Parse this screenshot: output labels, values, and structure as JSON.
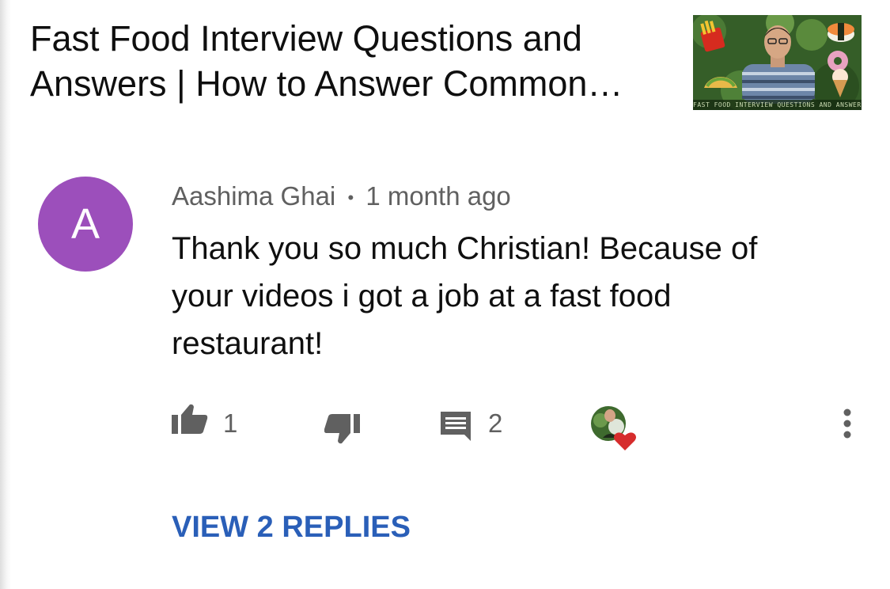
{
  "video": {
    "title_line1": "Fast Food Interview Questions and",
    "title_line2": "Answers | How to Answer Common…",
    "thumbnail_caption": "FAST FOOD INTERVIEW QUESTIONS AND ANSWERS"
  },
  "comment": {
    "avatar_letter": "A",
    "avatar_color": "#9c4fbb",
    "author": "Aashima Ghai",
    "separator": "•",
    "time": "1 month ago",
    "text": "Thank you so much Christian! Because of your videos i got a job at a fast food restaurant!",
    "like_count": "1",
    "reply_count": "2",
    "view_replies_label": "VIEW 2 REPLIES",
    "link_color": "#2a5fb8"
  },
  "icons": {
    "like": "thumb-up-icon",
    "dislike": "thumb-down-icon",
    "reply": "comment-icon",
    "creator_heart": "creator-heart-icon",
    "menu": "more-vert-icon"
  }
}
